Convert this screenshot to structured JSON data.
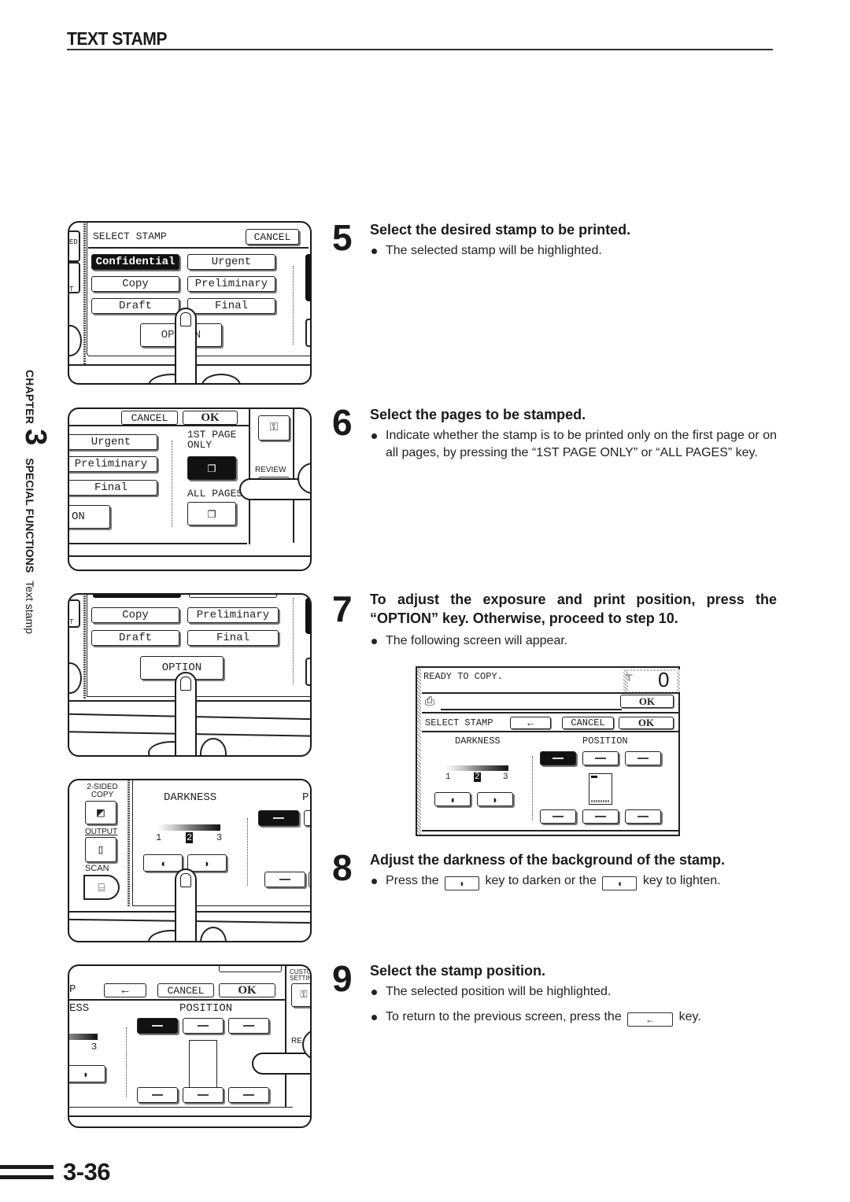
{
  "header": {
    "title": "TEXT STAMP"
  },
  "sidebar": {
    "chapter_label": "CHAPTER",
    "chapter_number": "3",
    "section": "SPECIAL FUNCTIONS",
    "subsection": "Text stamp"
  },
  "footer": {
    "page_number": "3-36"
  },
  "panels": {
    "p5": {
      "title": "SELECT STAMP",
      "cancel": "CANCEL",
      "stamps": [
        "Confidential",
        "Urgent",
        "Copy",
        "Preliminary",
        "Draft",
        "Final"
      ],
      "selected_stamp": "Confidential",
      "option": "OPTION",
      "option_visible": "OP      N",
      "side_fragments": [
        "ED",
        "T"
      ]
    },
    "p6": {
      "cancel": "CANCEL",
      "ok": "OK",
      "stamps": [
        "Urgent",
        "Preliminary",
        "Final"
      ],
      "option_fragment": "ON",
      "first_page_only": "1ST PAGE\nONLY",
      "first_page_line1": "1ST PAGE",
      "first_page_line2": "ONLY",
      "all_pages": "ALL PAGES",
      "review": "REVIEW"
    },
    "p7": {
      "stamps": [
        "Copy",
        "Preliminary",
        "Draft",
        "Final"
      ],
      "option": "OPTION",
      "side_fragment": "T"
    },
    "p8": {
      "two_sided_copy": "2-SIDED\nCOPY",
      "two_sided_line1": "2-SIDED",
      "two_sided_line2": "COPY",
      "output": "OUTPUT",
      "scan": "SCAN",
      "darkness": "DARKNESS",
      "position_fragment": "P",
      "levels": [
        "1",
        "2",
        "3"
      ],
      "selected_level": "2"
    },
    "p9": {
      "title_fragment": "P",
      "back_arrow": "←",
      "cancel": "CANCEL",
      "ok": "OK",
      "darkness_fragment": "ESS",
      "position": "POSITION",
      "level_fragment": "3",
      "custom_settings": "CUSTOM\nSETTINGS",
      "custom_line1": "CUSTO",
      "custom_line2": "SETTIN",
      "review_fragment": "RE"
    }
  },
  "screen": {
    "status": "READY TO COPY.",
    "copy_count": "0",
    "ok_top": "OK",
    "title": "SELECT STAMP",
    "back_arrow": "←",
    "cancel": "CANCEL",
    "ok": "OK",
    "darkness_label": "DARKNESS",
    "position_label": "POSITION",
    "darkness_levels": [
      "1",
      "2",
      "3"
    ],
    "selected_darkness": "2",
    "lighten_icon": "◖",
    "darken_icon": "◗",
    "positions": [
      "top-left",
      "top-center",
      "top-right",
      "bottom-left",
      "bottom-center",
      "bottom-right"
    ],
    "selected_position": "top-left"
  },
  "steps": [
    {
      "number": "5",
      "title": "Select the desired stamp to be printed.",
      "bullets": [
        "The selected stamp will be highlighted."
      ]
    },
    {
      "number": "6",
      "title": "Select the pages to be stamped.",
      "bullets": [
        "Indicate whether the stamp is to be printed only on the first page or on all pages, by pressing the “1ST PAGE ONLY” or “ALL PAGES” key."
      ]
    },
    {
      "number": "7",
      "title": "To adjust the exposure and print position, press the “OPTION” key. Otherwise, proceed to step 10.",
      "bullets": [
        "The following screen will appear."
      ]
    },
    {
      "number": "8",
      "title": "Adjust the darkness of the background of the stamp.",
      "bullet_parts": [
        "Press the",
        "key to darken or the",
        "key to lighten."
      ],
      "darken_key_icon": "◗",
      "lighten_key_icon": "◖"
    },
    {
      "number": "9",
      "title": "Select the stamp position.",
      "bullets": [
        "The selected position will be highlighted."
      ],
      "bullet2_parts": [
        "To return to the previous screen, press the",
        "key."
      ],
      "back_key_icon": "←"
    }
  ]
}
